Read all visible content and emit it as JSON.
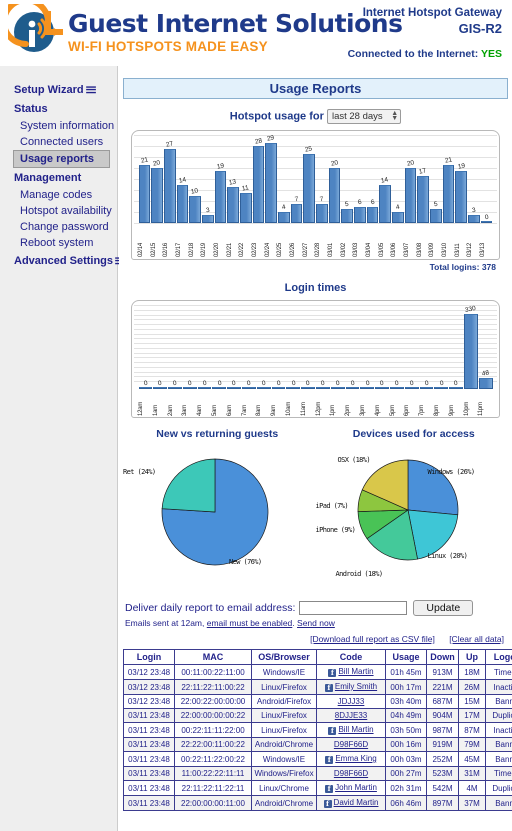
{
  "header": {
    "brand_name": "Guest Internet Solutions",
    "brand_tagline": "WI-FI HOTSPOTS MADE EASY",
    "gateway_line1": "Internet Hotspot Gateway",
    "gateway_line2": "GIS-R2",
    "connected_label": "Connected to the Internet:",
    "connected_value": "YES",
    "connected_color": "#00a100",
    "brand_blue": "#1f3a8a",
    "brand_orange": "#f5921e"
  },
  "sidebar": {
    "groups": [
      {
        "heading": "Setup Wizard",
        "caret": "☰",
        "items": []
      },
      {
        "heading": "Status",
        "items": [
          "System information",
          "Connected users",
          "Usage reports"
        ]
      },
      {
        "heading": "Management",
        "items": [
          "Manage codes",
          "Hotspot availability",
          "Change password",
          "Reboot system"
        ]
      },
      {
        "heading": "Advanced Settings",
        "caret": "☰",
        "items": []
      }
    ],
    "selected_item": "Usage reports"
  },
  "main": {
    "page_title": "Usage Reports",
    "usage_caption": "Hotspot usage for",
    "range_selected": "last 28 days",
    "total_logins_text": "Total logins: 378",
    "login_times_title": "Login times",
    "email": {
      "label": "Deliver daily report to email address:",
      "value": "",
      "placeholder": "",
      "update_label": "Update",
      "note_prefix": "Emails sent at 12am,",
      "note_link1": "email must be enabled",
      "note_mid": ".",
      "note_link2": "Send now"
    },
    "links": {
      "csv": "[Download full report as CSV file]",
      "clear": "[Clear all data]"
    }
  },
  "chart_data": [
    {
      "type": "bar",
      "title": "Hotspot usage for last 28 days",
      "xlabel": "",
      "ylabel": "",
      "ylim": [
        0,
        32
      ],
      "grid": true,
      "categories": [
        "02/14",
        "02/15",
        "02/16",
        "02/17",
        "02/18",
        "02/19",
        "02/20",
        "02/21",
        "02/22",
        "02/23",
        "02/24",
        "02/25",
        "02/26",
        "02/27",
        "02/28",
        "03/01",
        "03/02",
        "03/03",
        "03/04",
        "03/05",
        "03/06",
        "03/07",
        "03/08",
        "03/09",
        "03/10",
        "03/11",
        "03/12",
        "03/13"
      ],
      "values": [
        21,
        20,
        27,
        14,
        10,
        3,
        19,
        13,
        11,
        28,
        29,
        4,
        7,
        25,
        7,
        20,
        5,
        6,
        6,
        14,
        4,
        20,
        17,
        5,
        21,
        19,
        3,
        0
      ],
      "annotation": "Total logins: 378",
      "bar_color": "#4e84c2"
    },
    {
      "type": "bar",
      "title": "Login times",
      "xlabel": "",
      "ylabel": "",
      "ylim": [
        0,
        360
      ],
      "grid": true,
      "categories": [
        "12am",
        "1am",
        "2am",
        "3am",
        "4am",
        "5am",
        "6am",
        "7am",
        "8am",
        "9am",
        "10am",
        "11am",
        "12pm",
        "1pm",
        "2pm",
        "3pm",
        "4pm",
        "5pm",
        "6pm",
        "7pm",
        "8pm",
        "9pm",
        "10pm",
        "11pm"
      ],
      "values": [
        0,
        0,
        0,
        0,
        0,
        0,
        0,
        0,
        0,
        0,
        0,
        0,
        0,
        0,
        0,
        0,
        0,
        0,
        0,
        0,
        0,
        0,
        330,
        48
      ],
      "bar_color": "#4e84c2"
    },
    {
      "type": "pie",
      "title": "New vs returning guests",
      "legend": "labels-on-slices",
      "slices": [
        {
          "label": "New (76%)",
          "value": 76,
          "color": "#4a90d9"
        },
        {
          "label": "Ret (24%)",
          "value": 24,
          "color": "#3dc8b8"
        }
      ]
    },
    {
      "type": "pie",
      "title": "Devices used for access",
      "legend": "labels-on-slices",
      "slices": [
        {
          "label": "Windows (26%)",
          "value": 26,
          "color": "#4a90d9"
        },
        {
          "label": "Linux (20%)",
          "value": 20,
          "color": "#3ec6d6"
        },
        {
          "label": "Android (18%)",
          "value": 18,
          "color": "#44c99a"
        },
        {
          "label": "iPhone (9%)",
          "value": 9,
          "color": "#49c356"
        },
        {
          "label": "iPad (7%)",
          "value": 7,
          "color": "#8dc63f"
        },
        {
          "label": "OSX (18%)",
          "value": 18,
          "color": "#d9c74a"
        }
      ]
    }
  ],
  "table": {
    "columns": [
      "Login",
      "MAC",
      "OS/Browser",
      "Code",
      "Usage",
      "Down",
      "Up",
      "Logout"
    ],
    "rows": [
      {
        "login": "03/12 23:48",
        "mac": "00:11:00:22:11:00",
        "os": "Windows/IE",
        "code": "Bill Martin",
        "fb": true,
        "usage": "01h 45m",
        "down": "913M",
        "up": "18M",
        "logout": "Time Up"
      },
      {
        "login": "03/12 23:48",
        "mac": "22:11:22:11:00:22",
        "os": "Linux/Firefox",
        "code": "Emily Smith",
        "fb": true,
        "usage": "00h 17m",
        "down": "221M",
        "up": "26M",
        "logout": "Inactivity"
      },
      {
        "login": "03/12 23:48",
        "mac": "22:00:22:00:00:00",
        "os": "Android/Firefox",
        "code": "JDJJ33",
        "fb": false,
        "usage": "03h 40m",
        "down": "687M",
        "up": "15M",
        "logout": "Banned"
      },
      {
        "login": "03/11 23:48",
        "mac": "22:00:00:00:00:22",
        "os": "Linux/Firefox",
        "code": "8DJJE33",
        "fb": false,
        "usage": "04h 49m",
        "down": "904M",
        "up": "17M",
        "logout": "Duplicate"
      },
      {
        "login": "03/11 23:48",
        "mac": "00:22:11:11:22:00",
        "os": "Linux/Firefox",
        "code": "Bill Martin",
        "fb": true,
        "usage": "03h 50m",
        "down": "987M",
        "up": "87M",
        "logout": "Inactivity"
      },
      {
        "login": "03/11 23:48",
        "mac": "22:22:00:11:00:22",
        "os": "Android/Chrome",
        "code": "D98F66D",
        "fb": false,
        "usage": "00h 16m",
        "down": "919M",
        "up": "79M",
        "logout": "Banned"
      },
      {
        "login": "03/11 23:48",
        "mac": "00:22:11:22:00:22",
        "os": "Windows/IE",
        "code": "Emma King",
        "fb": true,
        "usage": "00h 03m",
        "down": "252M",
        "up": "45M",
        "logout": "Banned"
      },
      {
        "login": "03/11 23:48",
        "mac": "11:00:22:22:11:11",
        "os": "Windows/Firefox",
        "code": "D98F66D",
        "fb": false,
        "usage": "00h 27m",
        "down": "523M",
        "up": "31M",
        "logout": "Time Up"
      },
      {
        "login": "03/11 23:48",
        "mac": "22:11:22:11:22:11",
        "os": "Linux/Chrome",
        "code": "John Martin",
        "fb": true,
        "usage": "02h 31m",
        "down": "542M",
        "up": "4M",
        "logout": "Duplicate"
      },
      {
        "login": "03/11 23:48",
        "mac": "22:00:00:00:11:00",
        "os": "Android/Chrome",
        "code": "David Martin",
        "fb": true,
        "usage": "06h 46m",
        "down": "897M",
        "up": "37M",
        "logout": "Banned"
      }
    ]
  }
}
